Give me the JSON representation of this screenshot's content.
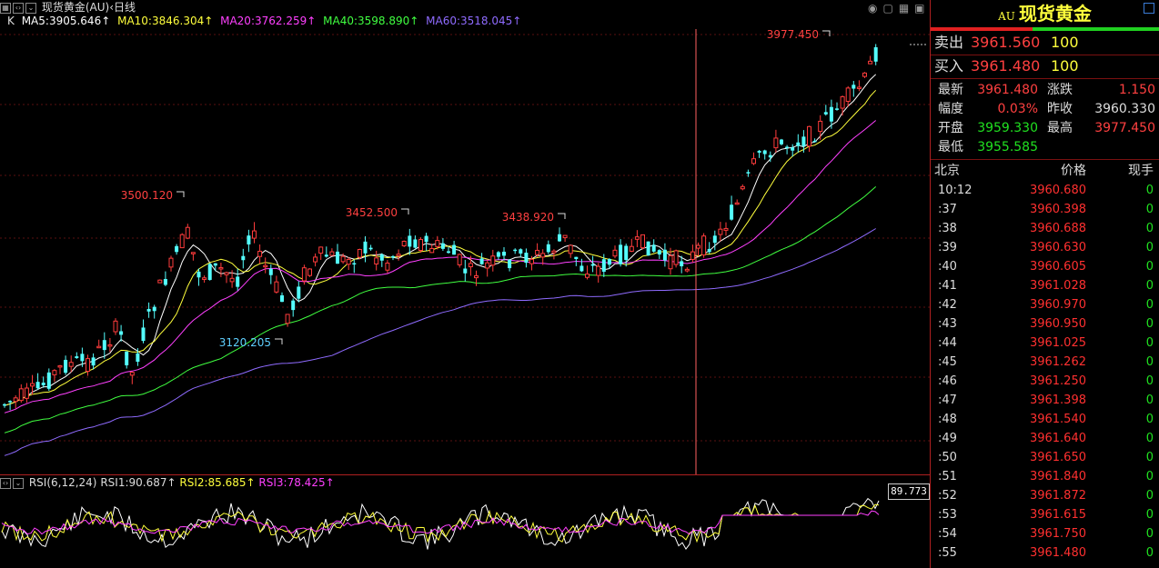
{
  "header": {
    "title": "现货黄金(AU)",
    "period": "日线",
    "ma_prefix": "K"
  },
  "ma": [
    {
      "label": "MA5:3905.646↑",
      "color": "#ffffff"
    },
    {
      "label": "MA10:3846.304↑",
      "color": "#ffff3c"
    },
    {
      "label": "MA20:3762.259↑",
      "color": "#ff40ff"
    },
    {
      "label": "MA40:3598.890↑",
      "color": "#40ff40"
    },
    {
      "label": "MA60:3518.045↑",
      "color": "#8f6bff"
    }
  ],
  "annotations": [
    {
      "text": "3977.450",
      "color": "#ff4040"
    },
    {
      "text": "3500.120",
      "color": "#ff4040"
    },
    {
      "text": "3452.500",
      "color": "#ff4040"
    },
    {
      "text": "3438.920",
      "color": "#ff4040"
    },
    {
      "text": "3120.205",
      "color": "#5fd0ff"
    }
  ],
  "rsi": {
    "label": "RSI(6,12,24)",
    "rsi1": "RSI1:90.687↑",
    "rsi2": "RSI2:85.685↑",
    "rsi3": "RSI3:78.425↑",
    "value_box": "89.773"
  },
  "icons": [
    "eye-icon",
    "square-icon",
    "grid-icon",
    "window-icon"
  ],
  "panel": {
    "code": "AU",
    "name": "现货黄金",
    "sell_label": "卖出",
    "sell_price": "3961.560",
    "sell_vol": "100",
    "buy_label": "买入",
    "buy_price": "3961.480",
    "buy_vol": "100",
    "quote": {
      "latest_label": "最新",
      "latest": "3961.480",
      "change_label": "涨跌",
      "change": "1.150",
      "range_label": "幅度",
      "range": "0.03%",
      "prev_label": "昨收",
      "prev": "3960.330",
      "open_label": "开盘",
      "open": "3959.330",
      "high_label": "最高",
      "high": "3977.450",
      "low_label": "最低",
      "low": "3955.585"
    },
    "ticks_header": {
      "time": "北京",
      "price": "价格",
      "vol": "现手"
    },
    "ticks": [
      {
        "time": "10:12",
        "price": "3960.680",
        "vol": "0"
      },
      {
        "time": ":37",
        "price": "3960.398",
        "vol": "0"
      },
      {
        "time": ":38",
        "price": "3960.688",
        "vol": "0"
      },
      {
        "time": ":39",
        "price": "3960.630",
        "vol": "0"
      },
      {
        "time": ":40",
        "price": "3960.605",
        "vol": "0"
      },
      {
        "time": ":41",
        "price": "3961.028",
        "vol": "0"
      },
      {
        "time": ":42",
        "price": "3960.970",
        "vol": "0"
      },
      {
        "time": ":43",
        "price": "3960.950",
        "vol": "0"
      },
      {
        "time": ":44",
        "price": "3961.025",
        "vol": "0"
      },
      {
        "time": ":45",
        "price": "3961.262",
        "vol": "0"
      },
      {
        "time": ":46",
        "price": "3961.250",
        "vol": "0"
      },
      {
        "time": ":47",
        "price": "3961.398",
        "vol": "0"
      },
      {
        "time": ":48",
        "price": "3961.540",
        "vol": "0"
      },
      {
        "time": ":49",
        "price": "3961.640",
        "vol": "0"
      },
      {
        "time": ":50",
        "price": "3961.650",
        "vol": "0"
      },
      {
        "time": ":51",
        "price": "3961.840",
        "vol": "0"
      },
      {
        "time": ":52",
        "price": "3961.872",
        "vol": "0"
      },
      {
        "time": ":53",
        "price": "3961.615",
        "vol": "0"
      },
      {
        "time": ":54",
        "price": "3961.750",
        "vol": "0"
      },
      {
        "time": ":55",
        "price": "3961.480",
        "vol": "0"
      }
    ]
  }
}
